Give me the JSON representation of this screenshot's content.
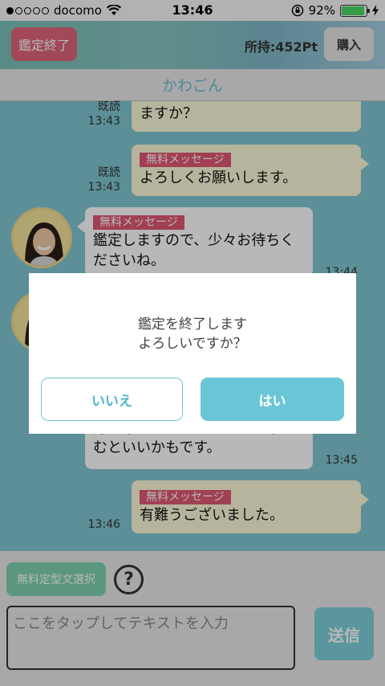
{
  "status_bar": {
    "carrier": "docomo",
    "time": "13:46",
    "battery": "92%",
    "battery_level": 0.92
  },
  "header": {
    "end_label": "鑑定終了",
    "points": "所持:452Pt",
    "buy_label": "購入"
  },
  "partner": {
    "name": "かわごん"
  },
  "messages": [
    {
      "side": "user",
      "tag": "",
      "text": "ますか？",
      "read": "既読",
      "time": "13:43"
    },
    {
      "side": "user",
      "tag": "無料メッセージ",
      "text": "よろしくお願いします。",
      "read": "既読",
      "time": "13:43"
    },
    {
      "side": "partner",
      "tag": "無料メッセージ",
      "text": "鑑定しますので、少々お待ちくださいね。",
      "read": "",
      "time": "13:44"
    },
    {
      "side": "partner",
      "tag": "",
      "text": "分の楽しいことをしっかり楽しむといいかもです。",
      "read": "",
      "time": "13:45"
    },
    {
      "side": "user",
      "tag": "無料メッセージ",
      "text": "有難うございました。",
      "read": "",
      "time": "13:46"
    }
  ],
  "dialog": {
    "message_line1": "鑑定を終了します",
    "message_line2": "よろしいですか？",
    "no_label": "いいえ",
    "yes_label": "はい"
  },
  "input": {
    "template_label": "無料定型文選択",
    "help_symbol": "?",
    "placeholder": "ここをタップしてテキストを入力",
    "send_label": "送信"
  },
  "colors": {
    "chat_bg": "#80c6d3",
    "accent": "#6ac6d6",
    "tag": "#e05873",
    "end_button": "#e0667a"
  }
}
